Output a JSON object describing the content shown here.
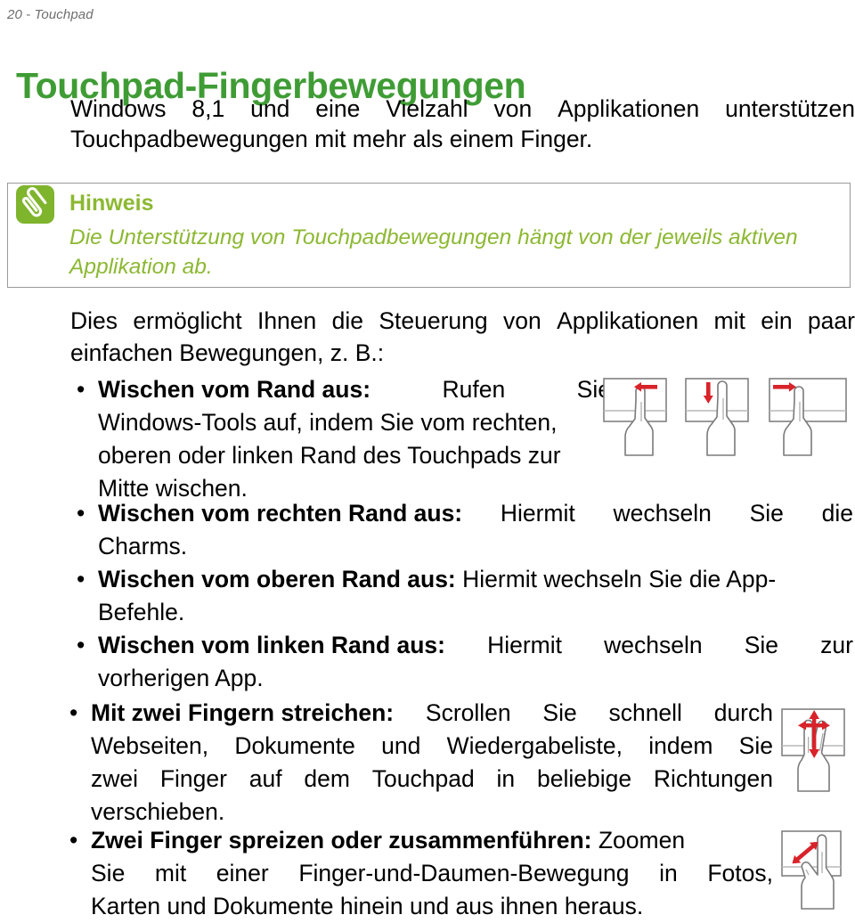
{
  "header": {
    "running_head": "20 - Touchpad"
  },
  "title": {
    "text": "Touchpad-Fingerbewegungen",
    "color": "#3f9c35"
  },
  "intro": {
    "line1_words": [
      "Windows",
      "8,1",
      "und",
      "eine",
      "Vielzahl",
      "von",
      "Applikationen",
      "unterstützen"
    ],
    "line2": "Touchpadbewegungen mit mehr als einem Finger."
  },
  "note": {
    "icon": "paperclip-icon",
    "title": "Hinweis",
    "color": "#8cb832",
    "border_color": "#9a9a9a",
    "body_line1": "Die Unterstützung von Touchpadbewegungen hängt von der jeweils aktiven",
    "body_line2": "Applikation ab."
  },
  "lead": {
    "line1_words": [
      "Dies",
      "ermöglicht",
      "Ihnen",
      "die",
      "Steuerung",
      "von",
      "Applikationen",
      "mit",
      "ein",
      "paar"
    ],
    "line2": "einfachen Bewegungen, z. B.:"
  },
  "bullets": [
    {
      "id": "bullet-rand",
      "marker": "•",
      "bold_label": "Wischen vom Rand aus:",
      "lines": [
        {
          "justify": true,
          "words": [
            "__LABEL__",
            "Rufen",
            "Sie"
          ]
        },
        {
          "justify": false,
          "text": "Windows-Tools auf, indem Sie vom rechten,"
        },
        {
          "justify": false,
          "text": "oberen oder linken Rand des Touchpads zur"
        },
        {
          "justify": false,
          "text": "Mitte wischen."
        }
      ]
    },
    {
      "id": "bullet-rechts",
      "marker": "•",
      "bold_label": "Wischen vom rechten Rand aus:",
      "lines": [
        {
          "justify": true,
          "words": [
            "__LABEL__",
            "Hiermit",
            "wechseln",
            "Sie",
            "die"
          ]
        },
        {
          "justify": false,
          "text": "Charms."
        }
      ]
    },
    {
      "id": "bullet-oben",
      "marker": "•",
      "bold_label": "Wischen vom oberen Rand aus:",
      "lines": [
        {
          "justify": false,
          "text": "__LABEL__ Hiermit wechseln Sie die App-"
        },
        {
          "justify": false,
          "text": "Befehle."
        }
      ]
    },
    {
      "id": "bullet-links",
      "marker": "•",
      "bold_label": "Wischen vom linken Rand aus:",
      "lines": [
        {
          "justify": true,
          "words": [
            "__LABEL__",
            "Hiermit",
            "wechseln",
            "Sie",
            "zur"
          ]
        },
        {
          "justify": false,
          "text": "vorherigen App."
        }
      ]
    },
    {
      "id": "bullet-zweifinger",
      "marker": "•",
      "bold_label": "Mit zwei Fingern streichen:",
      "lines": [
        {
          "justify": true,
          "words": [
            "__LABEL__",
            "Scrollen",
            "Sie",
            "schnell",
            "durch"
          ]
        },
        {
          "justify": true,
          "words": [
            "Webseiten,",
            "Dokumente",
            "und",
            "Wiedergabeliste,",
            "indem",
            "Sie"
          ]
        },
        {
          "justify": true,
          "words": [
            "zwei",
            "Finger",
            "auf",
            "dem",
            "Touchpad",
            "in",
            "beliebige",
            "Richtungen"
          ]
        },
        {
          "justify": false,
          "text": "verschieben."
        }
      ]
    },
    {
      "id": "bullet-spreizen",
      "marker": "•",
      "bold_label": "Zwei Finger spreizen oder zusammenführen:",
      "lines": [
        {
          "justify": false,
          "text": "__LABEL__ Zoomen"
        },
        {
          "justify": true,
          "words": [
            "Sie",
            "mit",
            "einer",
            "Finger-und-Daumen-Bewegung",
            "in",
            "Fotos,"
          ]
        },
        {
          "justify": false,
          "text": "Karten und Dokumente hinein und aus ihnen heraus."
        }
      ]
    }
  ],
  "gestures": [
    {
      "id": "gesture-right-edge",
      "name": "swipe-from-right-edge-icon",
      "arrow": "left",
      "arrow_color": "#d8232a"
    },
    {
      "id": "gesture-top-edge",
      "name": "swipe-from-top-edge-icon",
      "arrow": "down",
      "arrow_color": "#d8232a"
    },
    {
      "id": "gesture-left-edge",
      "name": "swipe-from-left-edge-icon",
      "arrow": "right",
      "arrow_color": "#d8232a"
    },
    {
      "id": "gesture-two-finger-scroll",
      "name": "two-finger-scroll-icon",
      "arrow": "four-way",
      "arrow_color": "#d8232a"
    },
    {
      "id": "gesture-pinch-zoom",
      "name": "pinch-zoom-icon",
      "arrow": "diagonal-double",
      "arrow_color": "#d8232a"
    }
  ]
}
